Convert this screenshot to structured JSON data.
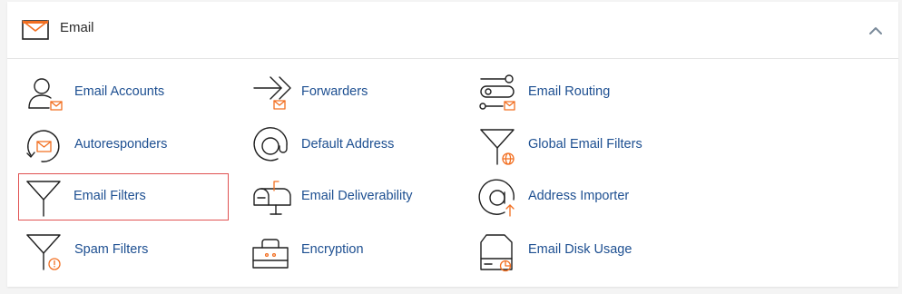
{
  "section": {
    "title": "Email",
    "accent_color": "#f26f21",
    "link_color": "#1d4f91",
    "header_icon": "envelope-icon",
    "collapse_icon": "chevron-up-icon"
  },
  "items": [
    {
      "label": "Email Accounts",
      "icon": "email-accounts-icon"
    },
    {
      "label": "Forwarders",
      "icon": "forwarders-icon"
    },
    {
      "label": "Email Routing",
      "icon": "email-routing-icon"
    },
    {
      "label": "Autoresponders",
      "icon": "autoresponders-icon"
    },
    {
      "label": "Default Address",
      "icon": "default-address-icon"
    },
    {
      "label": "Global Email Filters",
      "icon": "global-email-filters-icon"
    },
    {
      "label": "Email Filters",
      "icon": "email-filters-icon",
      "selected": true
    },
    {
      "label": "Email Deliverability",
      "icon": "email-deliverability-icon"
    },
    {
      "label": "Address Importer",
      "icon": "address-importer-icon"
    },
    {
      "label": "Spam Filters",
      "icon": "spam-filters-icon"
    },
    {
      "label": "Encryption",
      "icon": "encryption-icon"
    },
    {
      "label": "Email Disk Usage",
      "icon": "email-disk-usage-icon"
    }
  ]
}
